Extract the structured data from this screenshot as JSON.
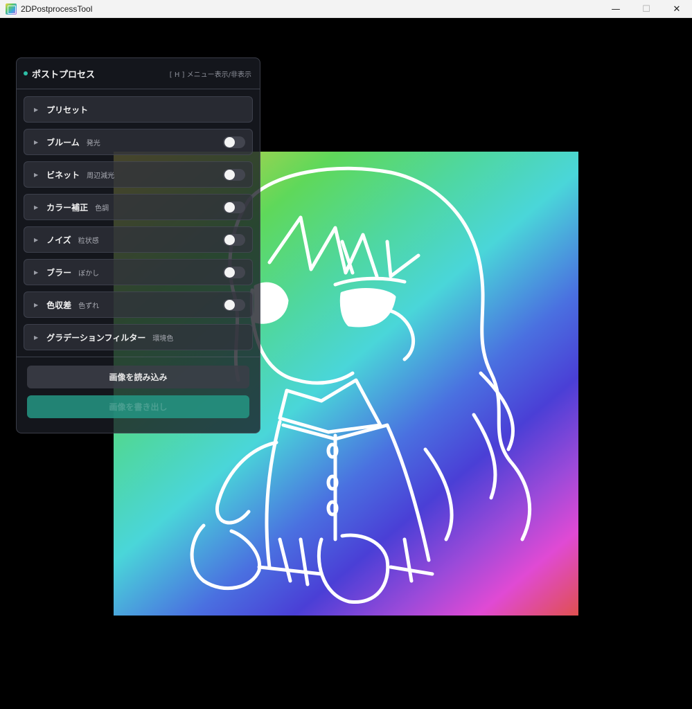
{
  "window": {
    "title": "2DPostprocessTool",
    "minimize_glyph": "—",
    "maximize_glyph": "☐",
    "close_glyph": "✕"
  },
  "panel": {
    "title": "ポストプロセス",
    "hint": "[ H ] メニュー表示/非表示",
    "sections": [
      {
        "label": "プリセット",
        "sub": "",
        "has_toggle": false
      },
      {
        "label": "ブルーム",
        "sub": "発光",
        "has_toggle": true,
        "enabled": false
      },
      {
        "label": "ビネット",
        "sub": "周辺減光",
        "has_toggle": true,
        "enabled": false
      },
      {
        "label": "カラー補正",
        "sub": "色調",
        "has_toggle": true,
        "enabled": false
      },
      {
        "label": "ノイズ",
        "sub": "粒状感",
        "has_toggle": true,
        "enabled": false
      },
      {
        "label": "ブラー",
        "sub": "ぼかし",
        "has_toggle": true,
        "enabled": false
      },
      {
        "label": "色収差",
        "sub": "色ずれ",
        "has_toggle": true,
        "enabled": false
      },
      {
        "label": "グラデーションフィルター",
        "sub": "環境色",
        "has_toggle": false
      }
    ],
    "load_button": "画像を読み込み",
    "export_button": "画像を書き出し"
  },
  "colors": {
    "accent": "#2dbfa6",
    "export_button": "#249684"
  },
  "icons": {
    "app": "app-icon",
    "expand": "triangle-right-icon"
  }
}
